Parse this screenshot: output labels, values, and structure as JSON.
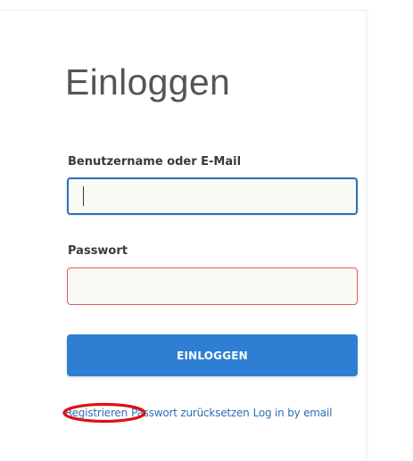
{
  "page": {
    "title": "Einloggen"
  },
  "form": {
    "username_label": "Benutzername oder E-Mail",
    "username_value": "",
    "password_label": "Passwort",
    "password_value": "",
    "submit_label": "EINLOGGEN"
  },
  "links": {
    "register": "Registrieren",
    "reset_password": "Passwort zurücksetzen",
    "email_login": "Log in by email"
  },
  "colors": {
    "accent": "#2e7fd3",
    "focus_border": "#2f6fb8",
    "error_border": "#e05b5b",
    "annotation": "#e01010"
  },
  "icons": {
    "annotation": "red-ellipse-highlight"
  }
}
